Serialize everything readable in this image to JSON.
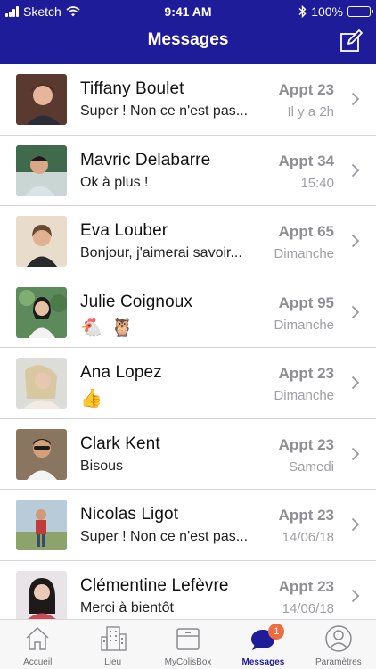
{
  "status_bar": {
    "carrier": "Sketch",
    "time": "9:41 AM",
    "battery": "100%"
  },
  "nav": {
    "title": "Messages"
  },
  "conversations": [
    {
      "name": "Tiffany Boulet",
      "preview": "Super ! Non ce n'est pas...",
      "apartment": "Appt 23",
      "time": "Il y a 2h"
    },
    {
      "name": "Mavric Delabarre",
      "preview": "Ok à plus !",
      "apartment": "Appt 34",
      "time": "15:40"
    },
    {
      "name": "Eva Louber",
      "preview": "Bonjour, j'aimerai savoir...",
      "apartment": "Appt 65",
      "time": "Dimanche"
    },
    {
      "name": "Julie Coignoux",
      "preview": "🐔 🦉",
      "apartment": "Appt 95",
      "time": "Dimanche"
    },
    {
      "name": "Ana Lopez",
      "preview": "👍",
      "apartment": "Appt 23",
      "time": "Dimanche"
    },
    {
      "name": "Clark Kent",
      "preview": "Bisous",
      "apartment": "Appt 23",
      "time": "Samedi"
    },
    {
      "name": "Nicolas Ligot",
      "preview": "Super ! Non ce n'est pas...",
      "apartment": "Appt 23",
      "time": "14/06/18"
    },
    {
      "name": "Clémentine Lefèvre",
      "preview": "Merci à bientôt",
      "apartment": "Appt 23",
      "time": "14/06/18"
    }
  ],
  "tabs": [
    {
      "label": "Accueil",
      "icon": "home-icon"
    },
    {
      "label": "Lieu",
      "icon": "building-icon"
    },
    {
      "label": "MyColisBox",
      "icon": "box-icon"
    },
    {
      "label": "Messages",
      "icon": "chat-icon",
      "badge": "1",
      "active": true
    },
    {
      "label": "Paramètres",
      "icon": "profile-icon"
    }
  ],
  "colors": {
    "brand": "#1f1c9a",
    "badge": "#ef6b42",
    "muted": "#8e8e93"
  }
}
